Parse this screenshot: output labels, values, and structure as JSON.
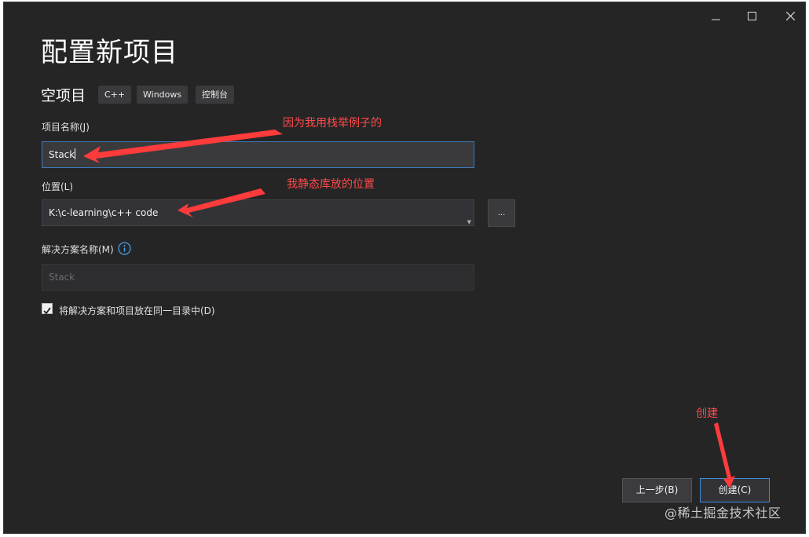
{
  "dialog": {
    "title": "配置新项目",
    "template_name": "空项目",
    "tags": [
      "C++",
      "Windows",
      "控制台"
    ]
  },
  "project_name": {
    "label": "项目名称(J)",
    "value": "Stack"
  },
  "location": {
    "label": "位置(L)",
    "value": "K:\\c-learning\\c++ code",
    "browse_label": "..."
  },
  "solution_name": {
    "label": "解决方案名称(M)",
    "placeholder": "Stack"
  },
  "same_dir_checkbox": {
    "label": "将解决方案和项目放在同一目录中(D)",
    "checked": true
  },
  "buttons": {
    "back": "上一步(B)",
    "create": "创建(C)"
  },
  "annotations": {
    "project_name_note": "因为我用栈举例子的",
    "location_note": "我静态库放的位置",
    "create_note": "创建",
    "color": "#ff3b3b"
  },
  "watermark": "@稀土掘金技术社区",
  "icons": {
    "minimize": "minimize-icon",
    "maximize": "maximize-icon",
    "close": "close-icon",
    "info": "info-icon",
    "check": "check-icon",
    "dropdown": "chevron-down-icon"
  }
}
